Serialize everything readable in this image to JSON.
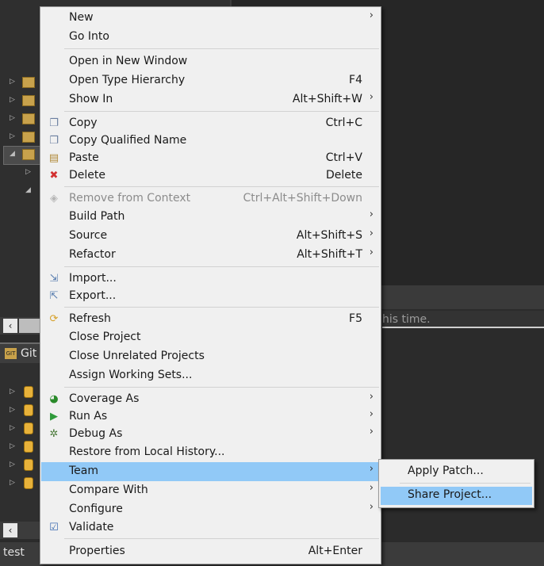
{
  "status_bar": {
    "text": "test"
  },
  "git_view": {
    "tab_label": "Git",
    "tab_icon": "git-repository-icon"
  },
  "console": {
    "message_tail": "his time."
  },
  "menu": {
    "items": [
      {
        "label": "New",
        "shortcut": "",
        "submenu": true,
        "icon": ""
      },
      {
        "label": "Go Into",
        "shortcut": "",
        "submenu": false,
        "icon": ""
      },
      {
        "label": "Open in New Window",
        "shortcut": "",
        "submenu": false,
        "icon": ""
      },
      {
        "label": "Open Type Hierarchy",
        "shortcut": "F4",
        "submenu": false,
        "icon": ""
      },
      {
        "label": "Show In",
        "shortcut": "Alt+Shift+W",
        "submenu": true,
        "icon": ""
      },
      {
        "label": "Copy",
        "shortcut": "Ctrl+C",
        "submenu": false,
        "icon": "copy-icon"
      },
      {
        "label": "Copy Qualified Name",
        "shortcut": "",
        "submenu": false,
        "icon": "copy-qualified-name-icon"
      },
      {
        "label": "Paste",
        "shortcut": "Ctrl+V",
        "submenu": false,
        "icon": "paste-icon"
      },
      {
        "label": "Delete",
        "shortcut": "Delete",
        "submenu": false,
        "icon": "delete-icon"
      },
      {
        "label": "Remove from Context",
        "shortcut": "Ctrl+Alt+Shift+Down",
        "submenu": false,
        "icon": "remove-context-icon",
        "disabled": true
      },
      {
        "label": "Build Path",
        "shortcut": "",
        "submenu": true,
        "icon": ""
      },
      {
        "label": "Source",
        "shortcut": "Alt+Shift+S",
        "submenu": true,
        "icon": ""
      },
      {
        "label": "Refactor",
        "shortcut": "Alt+Shift+T",
        "submenu": true,
        "icon": ""
      },
      {
        "label": "Import...",
        "shortcut": "",
        "submenu": false,
        "icon": "import-icon"
      },
      {
        "label": "Export...",
        "shortcut": "",
        "submenu": false,
        "icon": "export-icon"
      },
      {
        "label": "Refresh",
        "shortcut": "F5",
        "submenu": false,
        "icon": "refresh-icon"
      },
      {
        "label": "Close Project",
        "shortcut": "",
        "submenu": false,
        "icon": ""
      },
      {
        "label": "Close Unrelated Projects",
        "shortcut": "",
        "submenu": false,
        "icon": ""
      },
      {
        "label": "Assign Working Sets...",
        "shortcut": "",
        "submenu": false,
        "icon": ""
      },
      {
        "label": "Coverage As",
        "shortcut": "",
        "submenu": true,
        "icon": "coverage-icon"
      },
      {
        "label": "Run As",
        "shortcut": "",
        "submenu": true,
        "icon": "run-icon"
      },
      {
        "label": "Debug As",
        "shortcut": "",
        "submenu": true,
        "icon": "debug-icon"
      },
      {
        "label": "Restore from Local History...",
        "shortcut": "",
        "submenu": false,
        "icon": ""
      },
      {
        "label": "Team",
        "shortcut": "",
        "submenu": true,
        "icon": "",
        "highlighted": true
      },
      {
        "label": "Compare With",
        "shortcut": "",
        "submenu": true,
        "icon": ""
      },
      {
        "label": "Configure",
        "shortcut": "",
        "submenu": true,
        "icon": ""
      },
      {
        "label": "Validate",
        "shortcut": "",
        "submenu": false,
        "icon": "validate-check-icon"
      },
      {
        "label": "Properties",
        "shortcut": "Alt+Enter",
        "submenu": false,
        "icon": ""
      }
    ]
  },
  "team_submenu": {
    "items": [
      {
        "label": "Apply Patch..."
      },
      {
        "label": "Share Project...",
        "highlighted": true
      }
    ]
  },
  "colors": {
    "highlight": "#91c9f7",
    "menu_bg": "#f0f0f0",
    "ide_bg": "#2b2b2b"
  }
}
